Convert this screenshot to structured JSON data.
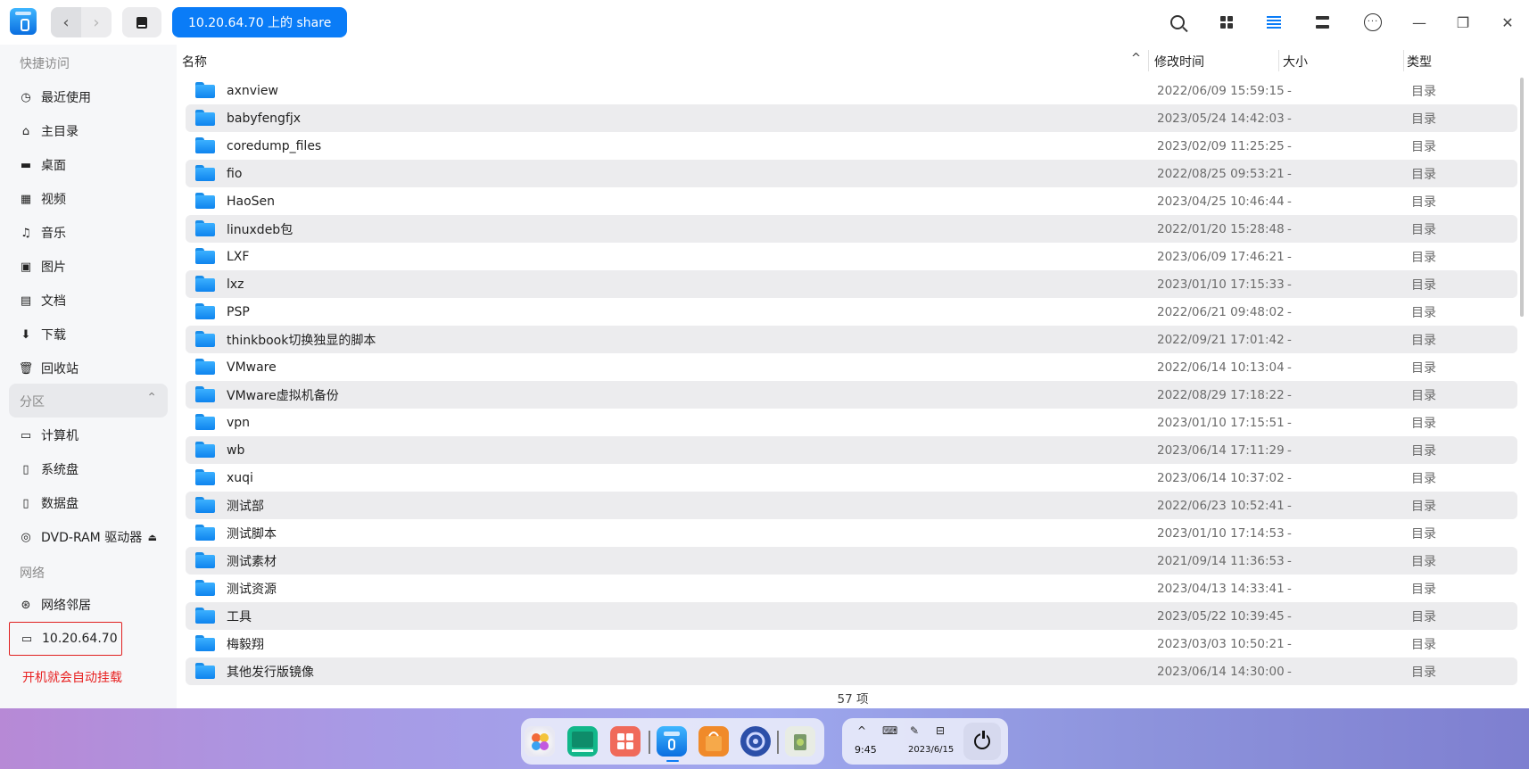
{
  "titlebar": {
    "back_symbol": "‹",
    "forward_symbol": "›",
    "breadcrumb": "10.20.64.70 上的 share",
    "icons": [
      "search-icon",
      "icon-view-icon",
      "list-view-icon",
      "detail-view-icon",
      "more-icon",
      "minimize-icon",
      "restore-icon",
      "close-icon"
    ],
    "window_controls": {
      "minimize": "—",
      "restore": "❐",
      "close": "✕"
    }
  },
  "sidebar": {
    "quick_access_label": "快捷访问",
    "quick_access": [
      {
        "label": "最近使用",
        "icon": "clock-icon",
        "glyph": "◷"
      },
      {
        "label": "主目录",
        "icon": "home-icon",
        "glyph": "⌂"
      },
      {
        "label": "桌面",
        "icon": "desktop-icon",
        "glyph": "▬"
      },
      {
        "label": "视频",
        "icon": "video-icon",
        "glyph": "▦"
      },
      {
        "label": "音乐",
        "icon": "music-icon",
        "glyph": "♫"
      },
      {
        "label": "图片",
        "icon": "picture-icon",
        "glyph": "▣"
      },
      {
        "label": "文档",
        "icon": "document-icon",
        "glyph": "▤"
      },
      {
        "label": "下载",
        "icon": "download-icon",
        "glyph": "⬇"
      },
      {
        "label": "回收站",
        "icon": "trash-icon",
        "glyph": "🗑"
      }
    ],
    "partition_label": "分区",
    "partition_chevron": "⌃",
    "partitions": [
      {
        "label": "计算机",
        "icon": "computer-icon",
        "glyph": "▭"
      },
      {
        "label": "系统盘",
        "icon": "system-disk-icon",
        "glyph": "▯"
      },
      {
        "label": "数据盘",
        "icon": "data-disk-icon",
        "glyph": "▯"
      },
      {
        "label": "DVD-RAM 驱动器",
        "icon": "dvd-icon",
        "glyph": "◎",
        "eject": "⏏"
      }
    ],
    "network_label": "网络",
    "network": [
      {
        "label": "网络邻居",
        "icon": "network-neighborhood-icon",
        "glyph": "⊛"
      },
      {
        "label": "10.20.64.70",
        "icon": "network-share-icon",
        "glyph": "▭"
      }
    ],
    "annotation": "开机就会自动挂载"
  },
  "columns": {
    "name": "名称",
    "modified": "修改时间",
    "size": "大小",
    "type": "类型",
    "sort_symbol": "^"
  },
  "files": [
    {
      "name": "axnview",
      "modified": "2022/06/09 15:59:15",
      "size": "-",
      "type": "目录"
    },
    {
      "name": "babyfengfjx",
      "modified": "2023/05/24 14:42:03",
      "size": "-",
      "type": "目录"
    },
    {
      "name": "coredump_files",
      "modified": "2023/02/09 11:25:25",
      "size": "-",
      "type": "目录"
    },
    {
      "name": "fio",
      "modified": "2022/08/25 09:53:21",
      "size": "-",
      "type": "目录"
    },
    {
      "name": "HaoSen",
      "modified": "2023/04/25 10:46:44",
      "size": "-",
      "type": "目录"
    },
    {
      "name": "linuxdeb包",
      "modified": "2022/01/20 15:28:48",
      "size": "-",
      "type": "目录"
    },
    {
      "name": "LXF",
      "modified": "2023/06/09 17:46:21",
      "size": "-",
      "type": "目录"
    },
    {
      "name": "lxz",
      "modified": "2023/01/10 17:15:33",
      "size": "-",
      "type": "目录"
    },
    {
      "name": "PSP",
      "modified": "2022/06/21 09:48:02",
      "size": "-",
      "type": "目录"
    },
    {
      "name": "thinkbook切换独显的脚本",
      "modified": "2022/09/21 17:01:42",
      "size": "-",
      "type": "目录"
    },
    {
      "name": "VMware",
      "modified": "2022/06/14 10:13:04",
      "size": "-",
      "type": "目录"
    },
    {
      "name": "VMware虚拟机备份",
      "modified": "2022/08/29 17:18:22",
      "size": "-",
      "type": "目录"
    },
    {
      "name": "vpn",
      "modified": "2023/01/10 17:15:51",
      "size": "-",
      "type": "目录"
    },
    {
      "name": "wb",
      "modified": "2023/06/14 17:11:29",
      "size": "-",
      "type": "目录"
    },
    {
      "name": "xuqi",
      "modified": "2023/06/14 10:37:02",
      "size": "-",
      "type": "目录"
    },
    {
      "name": "测试部",
      "modified": "2022/06/23 10:52:41",
      "size": "-",
      "type": "目录"
    },
    {
      "name": "测试脚本",
      "modified": "2023/01/10 17:14:53",
      "size": "-",
      "type": "目录"
    },
    {
      "name": "测试素材",
      "modified": "2021/09/14 11:36:53",
      "size": "-",
      "type": "目录"
    },
    {
      "name": "测试资源",
      "modified": "2023/04/13 14:33:41",
      "size": "-",
      "type": "目录"
    },
    {
      "name": "工具",
      "modified": "2023/05/22 10:39:45",
      "size": "-",
      "type": "目录"
    },
    {
      "name": "梅毅翔",
      "modified": "2023/03/03 10:50:21",
      "size": "-",
      "type": "目录"
    },
    {
      "name": "其他发行版镜像",
      "modified": "2023/06/14 14:30:00",
      "size": "-",
      "type": "目录"
    }
  ],
  "status": {
    "count": "57 项"
  },
  "taskbar": {
    "apps": [
      "launcher-icon",
      "terminal-icon",
      "app-store-grid-icon",
      "file-manager-icon",
      "app-store-bag-icon",
      "settings-icon",
      "trash-icon"
    ],
    "tray": {
      "time": "9:45",
      "date": "2023/6/15",
      "up_symbol": "^",
      "keyboard_symbol": "⌨",
      "pen_symbol": "✎",
      "toggle_symbol": "⊟"
    }
  },
  "colors": {
    "accent": "#0a7cf7",
    "annotation": "#e82020",
    "folder": "#1a8de8"
  }
}
